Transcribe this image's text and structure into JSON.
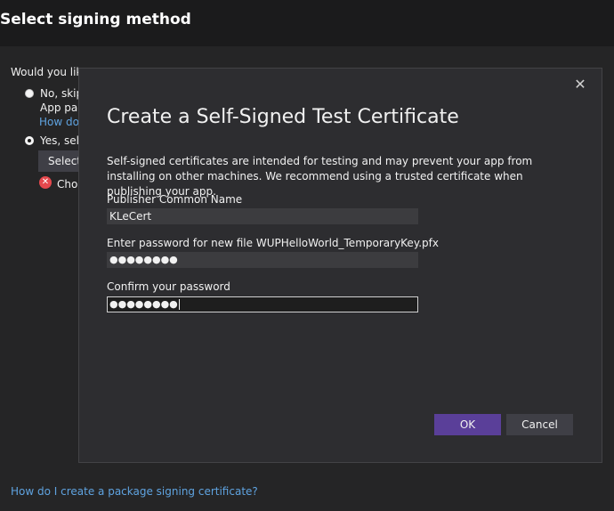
{
  "header": {
    "title": "Select signing method"
  },
  "background": {
    "question": "Would you like",
    "option_no": {
      "label": "No, skip",
      "line2": "App pac",
      "link": "How do"
    },
    "option_yes": {
      "label": "Yes, sele",
      "button": "Select",
      "error": "Choo"
    },
    "bottom_link": "How do I create a package signing certificate?"
  },
  "dialog": {
    "title": "Create a Self-Signed Test Certificate",
    "description": "Self-signed certificates are intended for testing and may prevent your app from installing on other machines. We recommend using a trusted certificate when publishing your app.",
    "publisher_label": "Publisher Common Name",
    "publisher_value": "KLeCert",
    "password_label": "Enter password for new file WUPHelloWorld_TemporaryKey.pfx",
    "password_value": "●●●●●●●●",
    "confirm_label": "Confirm your password",
    "confirm_value": "●●●●●●●●",
    "ok_label": "OK",
    "cancel_label": "Cancel",
    "close_glyph": "✕"
  },
  "colors": {
    "accent": "#5a3f99",
    "link": "#5fa3e0",
    "error": "#e5484d"
  }
}
